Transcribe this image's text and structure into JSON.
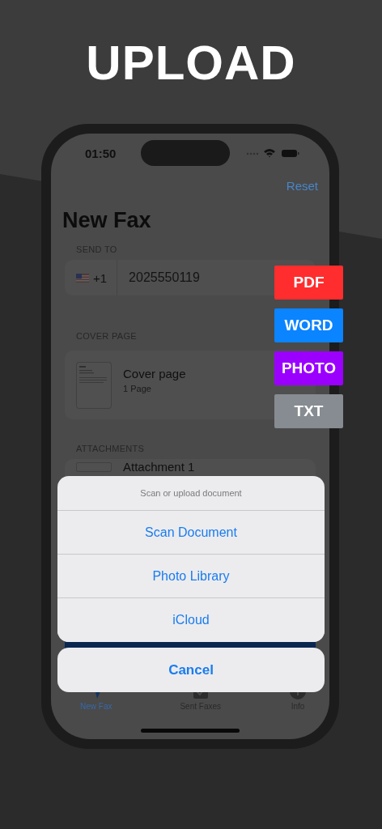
{
  "headline": "UPLOAD",
  "status_bar": {
    "time": "01:50"
  },
  "nav": {
    "action": "Reset",
    "title": "New Fax"
  },
  "send_to": {
    "heading": "SEND TO",
    "country_code": "+1",
    "number": "2025550119"
  },
  "cover_page": {
    "heading": "COVER PAGE",
    "title": "Cover page",
    "subtitle": "1 Page"
  },
  "attachments": {
    "heading": "ATTACHMENTS",
    "items": [
      {
        "title": "Attachment 1"
      }
    ]
  },
  "tab_bar": [
    {
      "label": "New Fax",
      "selected": true
    },
    {
      "label": "Sent Faxes",
      "selected": false
    },
    {
      "label": "Info",
      "selected": false
    }
  ],
  "action_sheet": {
    "title": "Scan or upload document",
    "options": [
      "Scan Document",
      "Photo Library",
      "iCloud"
    ],
    "cancel": "Cancel"
  },
  "file_types": [
    {
      "label": "PDF",
      "color": "#ff2d2d"
    },
    {
      "label": "WORD",
      "color": "#0a84ff"
    },
    {
      "label": "PHOTO",
      "color": "#9b00ff"
    },
    {
      "label": "TXT",
      "color": "#868c91"
    }
  ]
}
